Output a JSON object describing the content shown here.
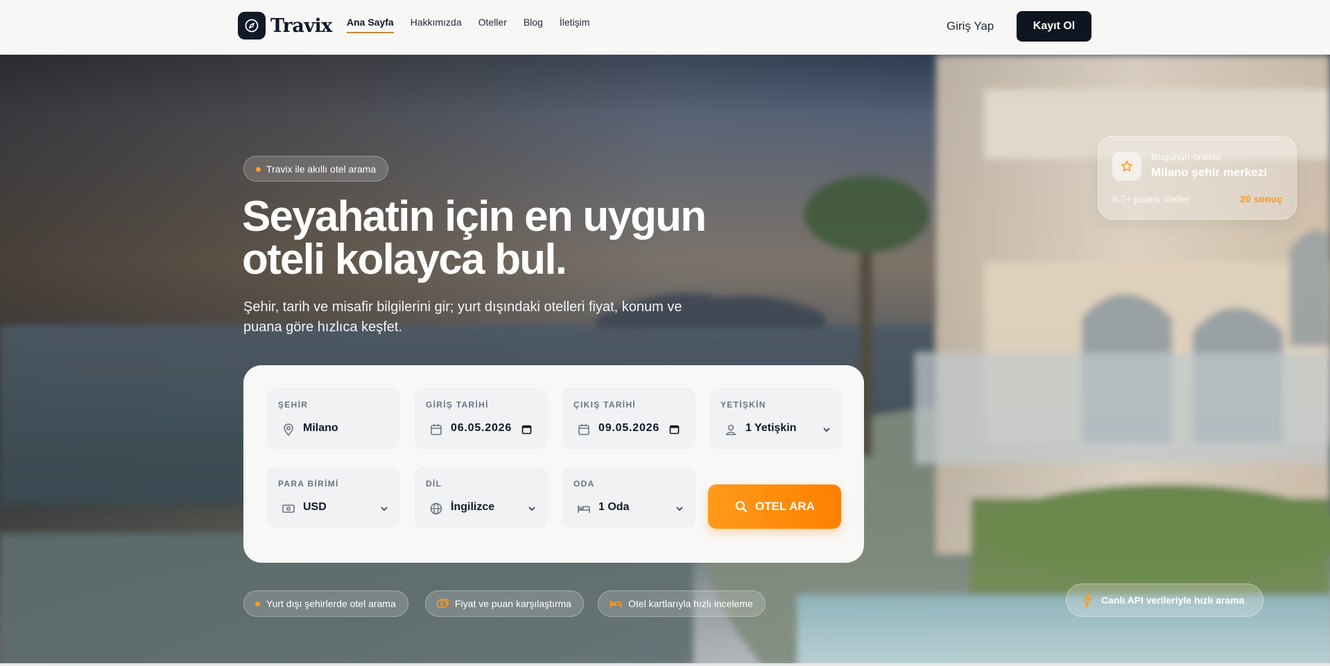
{
  "brand": {
    "name": "Travix"
  },
  "nav": {
    "items": [
      "Ana Sayfa",
      "Hakkımızda",
      "Oteller",
      "Blog",
      "İletişim"
    ],
    "active": "Ana Sayfa"
  },
  "auth": {
    "login": "Giriş Yap",
    "signup": "Kayıt Ol"
  },
  "hero": {
    "badge": "Travix ile akıllı otel arama",
    "title": "Seyahatin için en uygun oteli kolayca bul.",
    "subtitle": "Şehir, tarih ve misafir bilgilerini gir; yurt dışındaki otelleri fiyat, konum ve puana göre hızlıca keşfet."
  },
  "search": {
    "city": {
      "label": "ŞEHİR",
      "value": "Milano"
    },
    "checkin": {
      "label": "GİRİŞ TARİHİ",
      "value": "06.05.2026"
    },
    "checkout": {
      "label": "ÇIKIŞ TARİHİ",
      "value": "09.05.2026"
    },
    "adults": {
      "label": "YETİŞKİN",
      "value": "1 Yetişkin"
    },
    "currency": {
      "label": "PARA BİRİMİ",
      "value": "USD"
    },
    "language": {
      "label": "DİL",
      "value": "İngilizce"
    },
    "rooms": {
      "label": "ODA",
      "value": "1 Oda"
    },
    "button": "OTEL ARA"
  },
  "features": [
    {
      "label": "Yurt dışı şehirlerde otel arama",
      "icon": "dot-icon"
    },
    {
      "label": "Fiyat ve puan karşılaştırma",
      "icon": "money-icon"
    },
    {
      "label": "Otel kartlarıyla hızlı inceleme",
      "icon": "bed-icon"
    }
  ],
  "recommendation": {
    "caption": "Bugünün önerisi",
    "title": "Milano şehir merkezi",
    "meta": "8.7+ puanlı oteller",
    "count": "20 sonuç"
  },
  "live_badge": "Canlı API verileriyle hızlı arama",
  "colors": {
    "accent": "#ff8a00",
    "dark": "#0f1520"
  }
}
